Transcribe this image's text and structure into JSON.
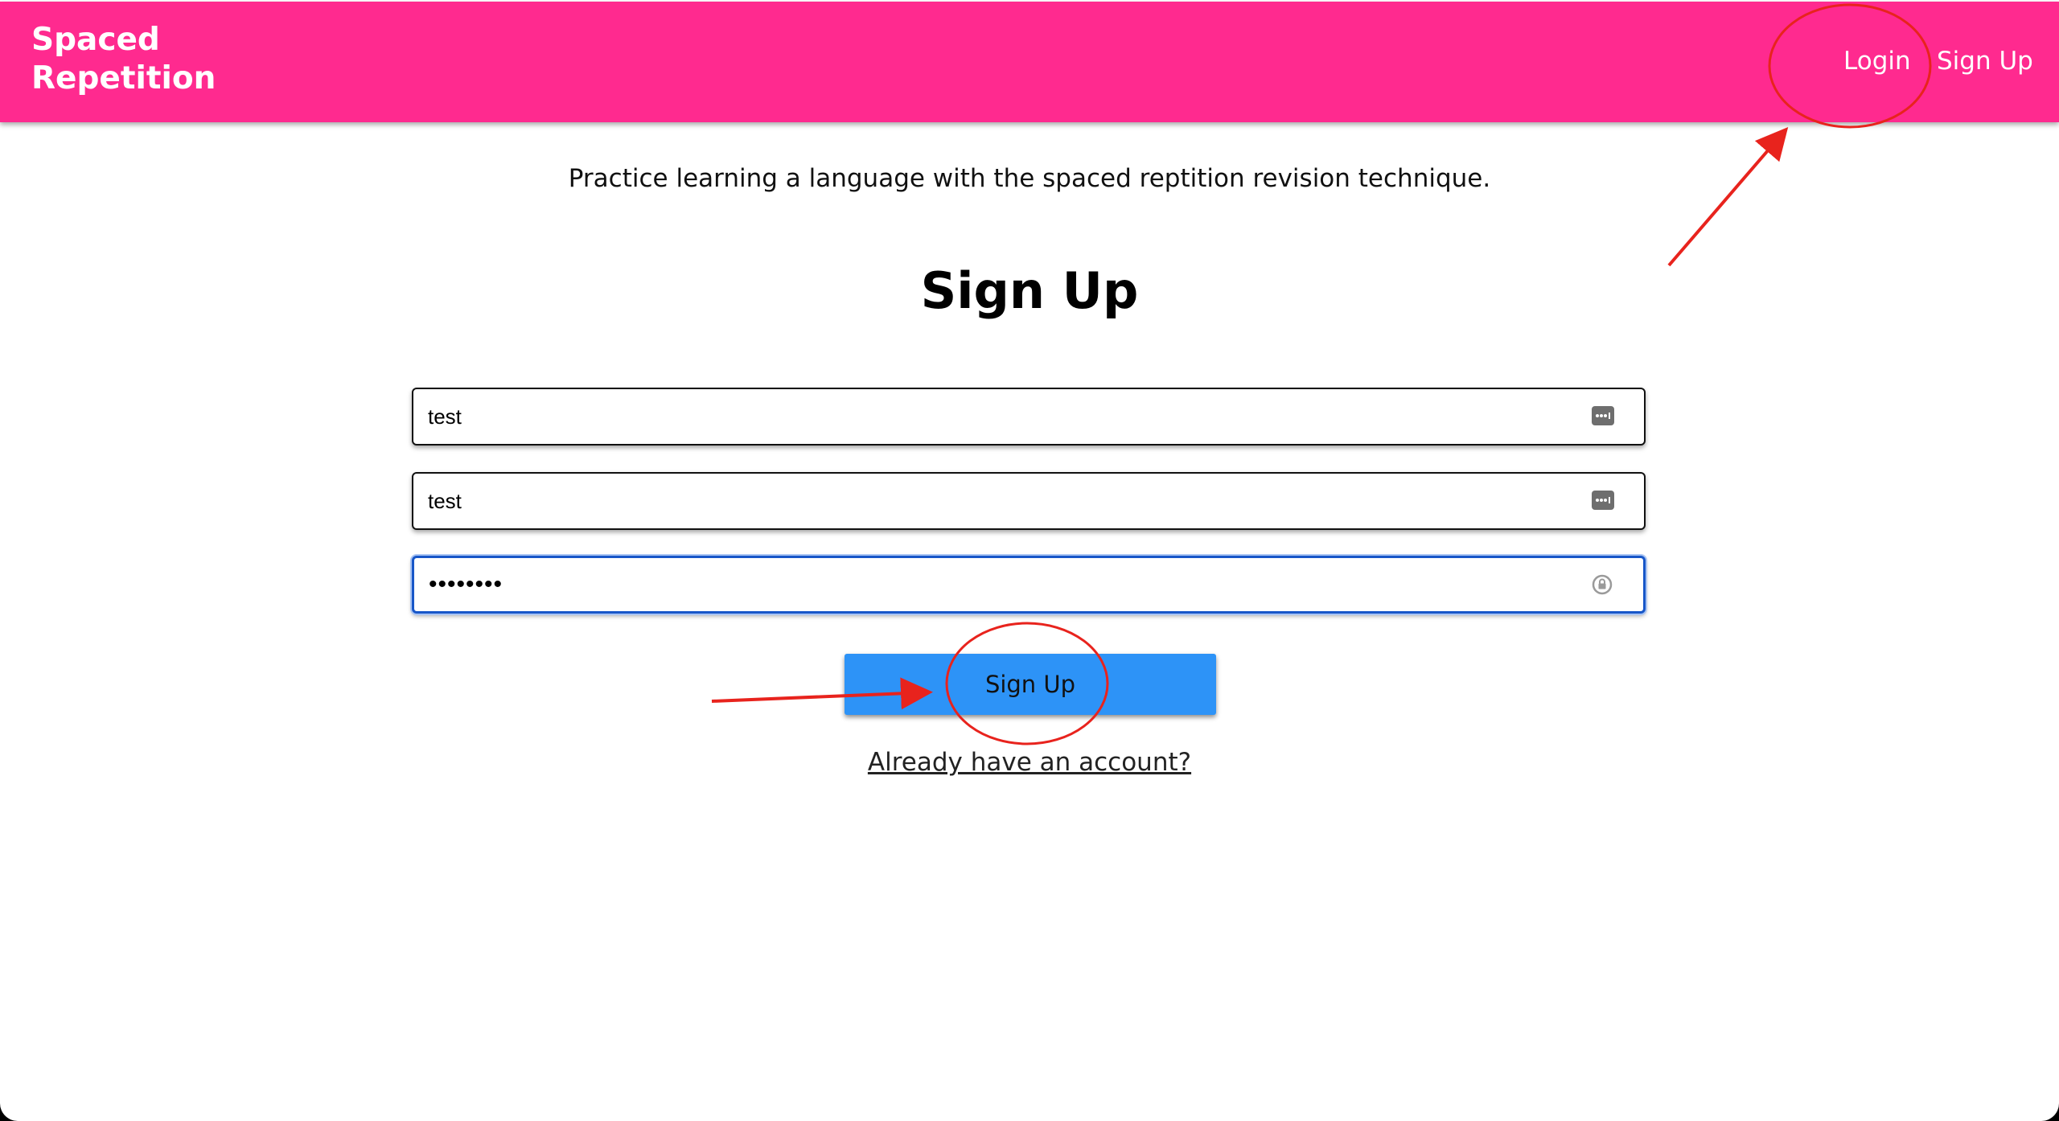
{
  "header": {
    "brand": "Spaced\nRepetition",
    "nav": {
      "login": "Login",
      "signup": "Sign Up"
    },
    "color": "#ff2a8f"
  },
  "main": {
    "tagline": "Practice learning a language with the spaced reptition revision technique.",
    "title": "Sign Up",
    "fields": [
      {
        "value": "test",
        "icon": "autofill-dots-icon"
      },
      {
        "value": "test",
        "icon": "autofill-dots-icon"
      },
      {
        "value": "••••••••",
        "icon": "password-key-icon"
      }
    ],
    "submit_label": "Sign Up",
    "already_link": "Already have an account?",
    "button_color": "#2d93f7"
  },
  "annotations": {
    "color": "#e8231d",
    "shapes": [
      "circle",
      "arrow"
    ]
  }
}
